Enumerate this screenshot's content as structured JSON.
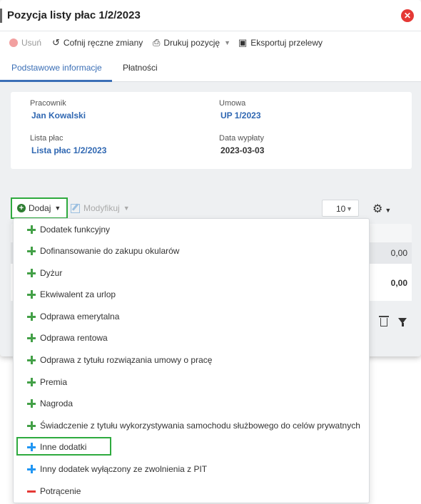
{
  "modal": {
    "title": "Pozycja listy płac 1/2/2023",
    "close_glyph": "✕"
  },
  "toolbar": {
    "delete_label": "Usuń",
    "undo_label": "Cofnij ręczne zmiany",
    "print_label": "Drukuj pozycję",
    "export_label": "Eksportuj przelewy"
  },
  "tabs": [
    {
      "label": "Podstawowe informacje",
      "active": true
    },
    {
      "label": "Płatności",
      "active": false
    }
  ],
  "info": {
    "employee_label": "Pracownik",
    "employee_value": "Jan Kowalski",
    "contract_label": "Umowa",
    "contract_value": "UP 1/2023",
    "payroll_label": "Lista płac",
    "payroll_value": "Lista płac 1/2/2023",
    "payout_label": "Data wypłaty",
    "payout_value": "2023-03-03"
  },
  "actions": {
    "add_label": "Dodaj",
    "modify_label": "Modyfikuj",
    "page_size": "10"
  },
  "table": {
    "row1_amount": "0,00",
    "row2_amount": "0,00"
  },
  "dropdown": {
    "items": [
      {
        "label": "Dodatek funkcyjny",
        "icon": "plus",
        "color": "#43a047"
      },
      {
        "label": "Dofinansowanie do zakupu okularów",
        "icon": "plus",
        "color": "#43a047"
      },
      {
        "label": "Dyżur",
        "icon": "plus",
        "color": "#43a047"
      },
      {
        "label": "Ekwiwalent za urlop",
        "icon": "plus",
        "color": "#43a047"
      },
      {
        "label": "Odprawa emerytalna",
        "icon": "plus",
        "color": "#43a047"
      },
      {
        "label": "Odprawa rentowa",
        "icon": "plus",
        "color": "#43a047"
      },
      {
        "label": "Odprawa z tytułu rozwiązania umowy o pracę",
        "icon": "plus",
        "color": "#43a047"
      },
      {
        "label": "Premia",
        "icon": "plus",
        "color": "#43a047"
      },
      {
        "label": "Nagroda",
        "icon": "plus",
        "color": "#43a047"
      },
      {
        "label": "Świadczenie z tytułu wykorzystywania samochodu służbowego do celów prywatnych",
        "icon": "plus",
        "color": "#43a047"
      },
      {
        "label": "Inne dodatki",
        "icon": "plus",
        "color": "#2196f3",
        "highlighted": true
      },
      {
        "label": "Inny dodatek wyłączony ze zwolnienia z PIT",
        "icon": "plus",
        "color": "#2196f3"
      },
      {
        "label": "Potrącenie",
        "icon": "minus",
        "color": "#e53935"
      }
    ]
  }
}
